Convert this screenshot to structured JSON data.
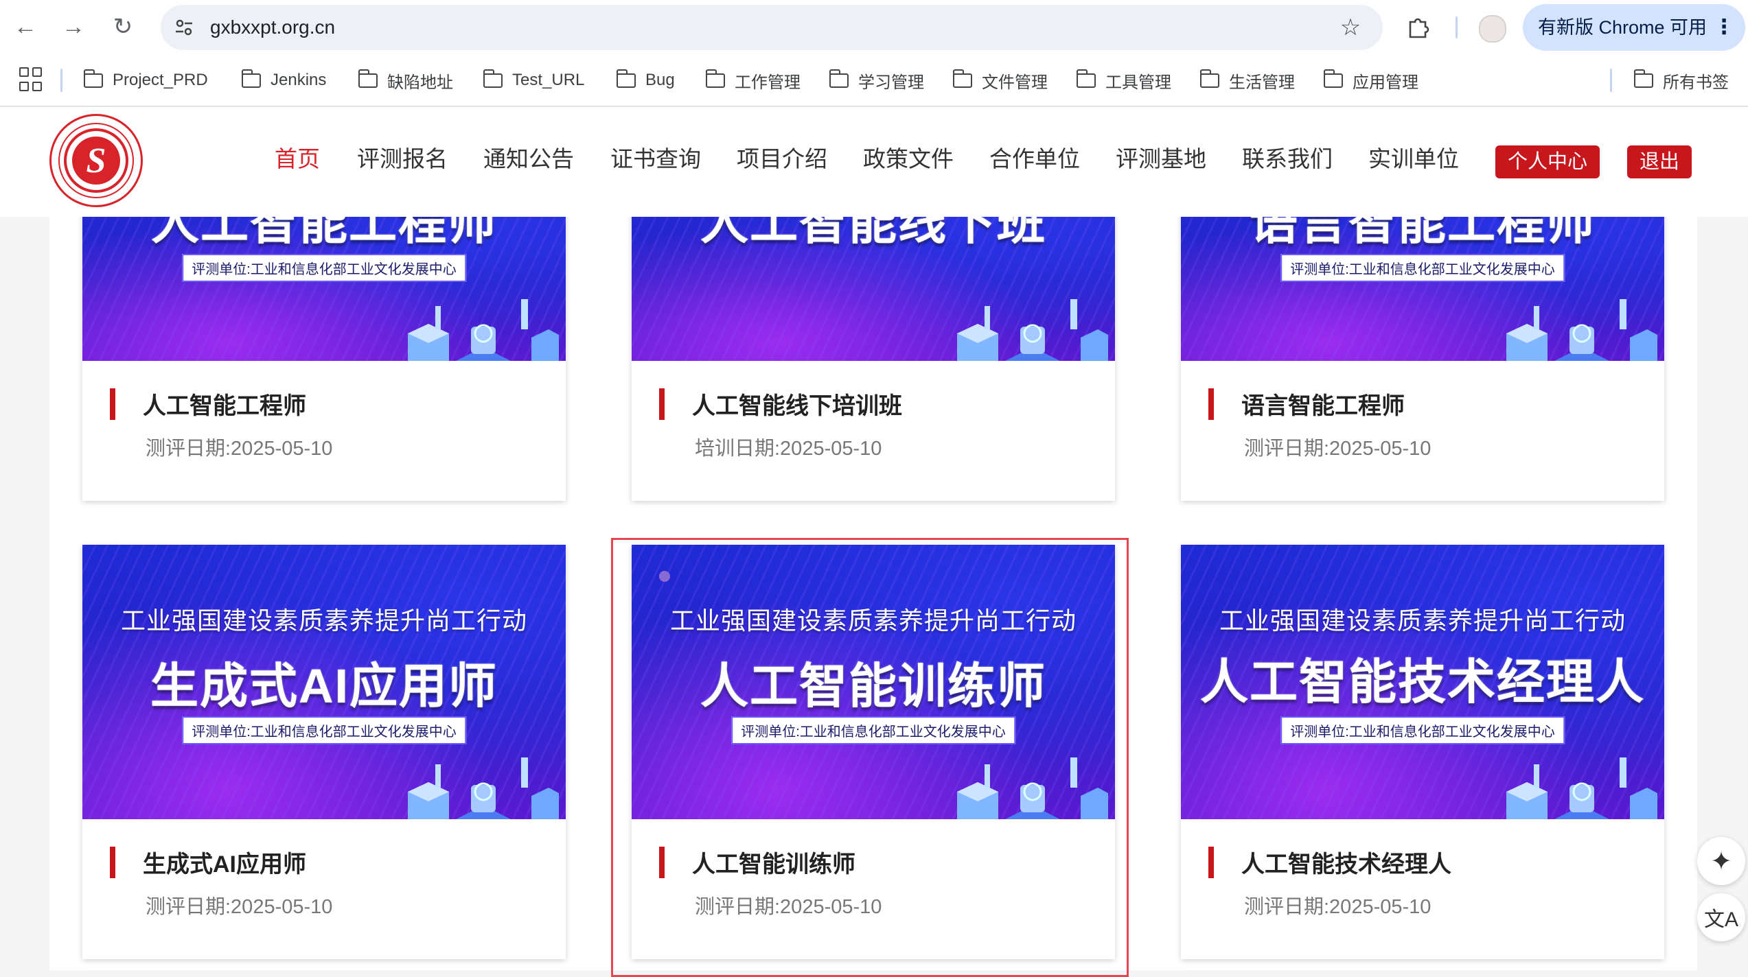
{
  "browser": {
    "url": "gxbxxpt.org.cn",
    "update_label": "有新版 Chrome 可用",
    "update_menu": "⋮",
    "back_icon": "←",
    "forward_icon": "→",
    "reload_icon": "↻",
    "tune_icon": "⚙",
    "star_icon": "☆"
  },
  "bookmarks": [
    {
      "label": "Project_PRD"
    },
    {
      "label": "Jenkins"
    },
    {
      "label": "缺陷地址"
    },
    {
      "label": "Test_URL"
    },
    {
      "label": "Bug"
    },
    {
      "label": "工作管理"
    },
    {
      "label": "学习管理"
    },
    {
      "label": "文件管理"
    },
    {
      "label": "工具管理"
    },
    {
      "label": "生活管理"
    },
    {
      "label": "应用管理"
    }
  ],
  "all_bookmarks": "所有书签",
  "site": {
    "nav": [
      {
        "label": "首页",
        "active": true
      },
      {
        "label": "评测报名"
      },
      {
        "label": "通知公告"
      },
      {
        "label": "证书查询"
      },
      {
        "label": "项目介绍"
      },
      {
        "label": "政策文件"
      },
      {
        "label": "合作单位"
      },
      {
        "label": "评测基地"
      },
      {
        "label": "联系我们"
      },
      {
        "label": "实训单位"
      }
    ],
    "personal_center": "个人中心",
    "logout": "退出",
    "accent_color": "#c8161d"
  },
  "cards": [
    {
      "banner_title": "人工智能工程师",
      "banner_unit": "评测单位:工业和信息化部工业文化发展中心",
      "title": "人工智能工程师",
      "date": "测评日期:2025-05-10"
    },
    {
      "banner_title": "人工智能线下班",
      "banner_unit": "",
      "title": "人工智能线下培训班",
      "date": "培训日期:2025-05-10"
    },
    {
      "banner_title": "语言智能工程师",
      "banner_unit": "评测单位:工业和信息化部工业文化发展中心",
      "title": "语言智能工程师",
      "date": "测评日期:2025-05-10"
    },
    {
      "banner_line1": "工业强国建设素质素养提升尚工行动",
      "banner_title": "生成式AI应用师",
      "banner_unit": "评测单位:工业和信息化部工业文化发展中心",
      "title": "生成式AI应用师",
      "date": "测评日期:2025-05-10"
    },
    {
      "banner_line1": "工业强国建设素质素养提升尚工行动",
      "banner_title": "人工智能训练师",
      "banner_unit": "评测单位:工业和信息化部工业文化发展中心",
      "title": "人工智能训练师",
      "date": "测评日期:2025-05-10"
    },
    {
      "banner_line1": "工业强国建设素质素养提升尚工行动",
      "banner_title": "人工智能技术经理人",
      "banner_unit": "评测单位:工业和信息化部工业文化发展中心",
      "title": "人工智能技术经理人",
      "date": "测评日期:2025-05-10"
    }
  ],
  "floating": {
    "ai_icon": "✦",
    "translate_icon": "文A"
  }
}
